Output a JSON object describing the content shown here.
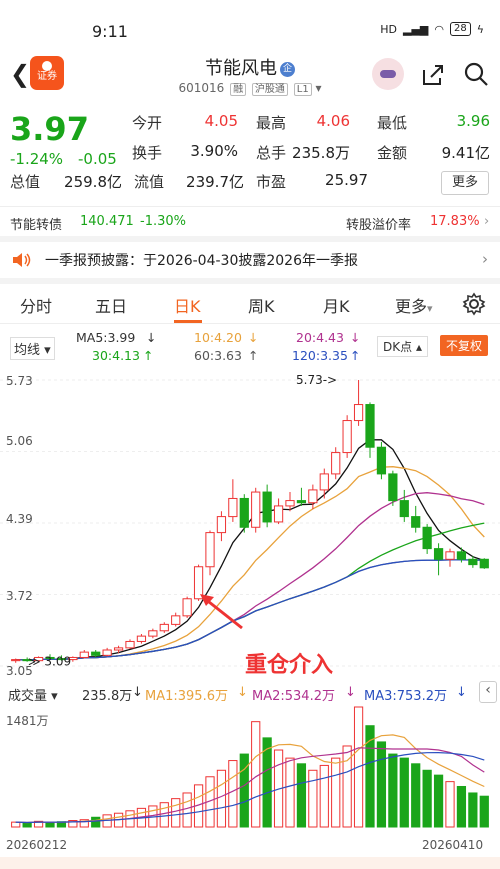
{
  "status": {
    "time": "9:11",
    "signal": "HD",
    "battery": "28"
  },
  "header": {
    "brand": "证券",
    "title": "节能风电",
    "enterprise_badge": "企",
    "code": "601016",
    "tags": [
      "融",
      "沪股通",
      "L1"
    ]
  },
  "quote": {
    "price": "3.97",
    "change_pct": "-1.24%",
    "change": "-0.05",
    "fields": [
      {
        "label": "今开",
        "value": "4.05",
        "color": "#e33"
      },
      {
        "label": "最高",
        "value": "4.06",
        "color": "#e33"
      },
      {
        "label": "最低",
        "value": "3.96",
        "color": "#1aa51a"
      },
      {
        "label": "换手",
        "value": "3.90%",
        "color": "#222"
      },
      {
        "label": "总手",
        "value": "235.8万",
        "color": "#222"
      },
      {
        "label": "金额",
        "value": "9.41亿",
        "color": "#222"
      },
      {
        "label": "总值",
        "value": "259.8亿",
        "color": "#222"
      },
      {
        "label": "流值",
        "value": "239.7亿",
        "color": "#222"
      },
      {
        "label": "市盈",
        "value": "25.97",
        "color": "#222"
      }
    ],
    "more": "更多"
  },
  "convert": {
    "label": "节能转债",
    "price": "140.471",
    "change": "-1.30%",
    "premium_label": "转股溢价率",
    "premium": "17.83%"
  },
  "notice": {
    "text": "一季报预披露：于2026-04-30披露2026年一季报"
  },
  "tabs": [
    "分时",
    "五日",
    "日K",
    "周K",
    "月K",
    "更多"
  ],
  "ma": {
    "selector": "均线",
    "ma5": "MA5:3.99",
    "ma10": "10:4.20",
    "ma20": "20:4.43",
    "ma30": "30:4.13",
    "ma60": "60:3.63",
    "ma120": "120:3.35",
    "dk": "DK点",
    "fq": "不复权"
  },
  "chart_data": {
    "type": "candlestick",
    "y_ticks": [
      "5.73",
      "5.06",
      "4.39",
      "3.72",
      "3.05"
    ],
    "ylim": [
      3.05,
      5.73
    ],
    "high_marker": "5.73->",
    "low_marker": "3.09",
    "annotation": "重仓介入",
    "candles": [
      [
        3.1,
        3.12,
        3.08,
        3.11
      ],
      [
        3.11,
        3.13,
        3.09,
        3.1
      ],
      [
        3.1,
        3.14,
        3.09,
        3.13
      ],
      [
        3.13,
        3.16,
        3.11,
        3.12
      ],
      [
        3.12,
        3.15,
        3.1,
        3.11
      ],
      [
        3.11,
        3.14,
        3.09,
        3.13
      ],
      [
        3.13,
        3.2,
        3.12,
        3.18
      ],
      [
        3.18,
        3.2,
        3.13,
        3.15
      ],
      [
        3.15,
        3.22,
        3.14,
        3.2
      ],
      [
        3.2,
        3.24,
        3.17,
        3.22
      ],
      [
        3.22,
        3.3,
        3.21,
        3.28
      ],
      [
        3.28,
        3.35,
        3.26,
        3.33
      ],
      [
        3.33,
        3.4,
        3.31,
        3.38
      ],
      [
        3.38,
        3.46,
        3.36,
        3.44
      ],
      [
        3.44,
        3.55,
        3.42,
        3.52
      ],
      [
        3.52,
        3.7,
        3.5,
        3.68
      ],
      [
        3.68,
        4.0,
        3.66,
        3.98
      ],
      [
        3.98,
        4.32,
        3.9,
        4.3
      ],
      [
        4.3,
        4.5,
        4.22,
        4.45
      ],
      [
        4.45,
        4.8,
        4.4,
        4.62
      ],
      [
        4.62,
        4.66,
        4.3,
        4.35
      ],
      [
        4.35,
        4.72,
        4.3,
        4.68
      ],
      [
        4.68,
        4.75,
        4.35,
        4.4
      ],
      [
        4.4,
        4.62,
        4.38,
        4.55
      ],
      [
        4.55,
        4.68,
        4.5,
        4.6
      ],
      [
        4.6,
        4.72,
        4.55,
        4.58
      ],
      [
        4.58,
        4.75,
        4.52,
        4.7
      ],
      [
        4.7,
        4.9,
        4.62,
        4.85
      ],
      [
        4.85,
        5.1,
        4.8,
        5.05
      ],
      [
        5.05,
        5.4,
        5.0,
        5.35
      ],
      [
        5.35,
        5.73,
        5.3,
        5.5
      ],
      [
        5.5,
        5.52,
        5.0,
        5.1
      ],
      [
        5.1,
        5.15,
        4.8,
        4.85
      ],
      [
        4.85,
        4.88,
        4.55,
        4.6
      ],
      [
        4.6,
        4.7,
        4.4,
        4.45
      ],
      [
        4.45,
        4.55,
        4.3,
        4.35
      ],
      [
        4.35,
        4.38,
        4.1,
        4.15
      ],
      [
        4.15,
        4.2,
        3.9,
        4.05
      ],
      [
        4.05,
        4.15,
        3.98,
        4.12
      ],
      [
        4.12,
        4.16,
        4.02,
        4.05
      ],
      [
        4.05,
        4.08,
        3.97,
        4.0
      ],
      [
        4.05,
        4.06,
        3.96,
        3.97
      ]
    ],
    "volume": {
      "label": "成交量",
      "value": "235.8万",
      "ma1": "MA1:395.6万",
      "ma2": "MA2:534.2万",
      "ma3": "MA3:753.2万",
      "y_max_label": "1481万",
      "values": [
        60,
        50,
        70,
        55,
        65,
        80,
        90,
        120,
        150,
        170,
        200,
        230,
        260,
        300,
        350,
        420,
        520,
        620,
        700,
        820,
        900,
        1300,
        1100,
        950,
        850,
        780,
        700,
        760,
        850,
        1000,
        1481,
        1250,
        1050,
        900,
        850,
        780,
        700,
        640,
        560,
        500,
        420,
        380
      ]
    },
    "x_labels": [
      "20260212",
      "20260410"
    ]
  }
}
